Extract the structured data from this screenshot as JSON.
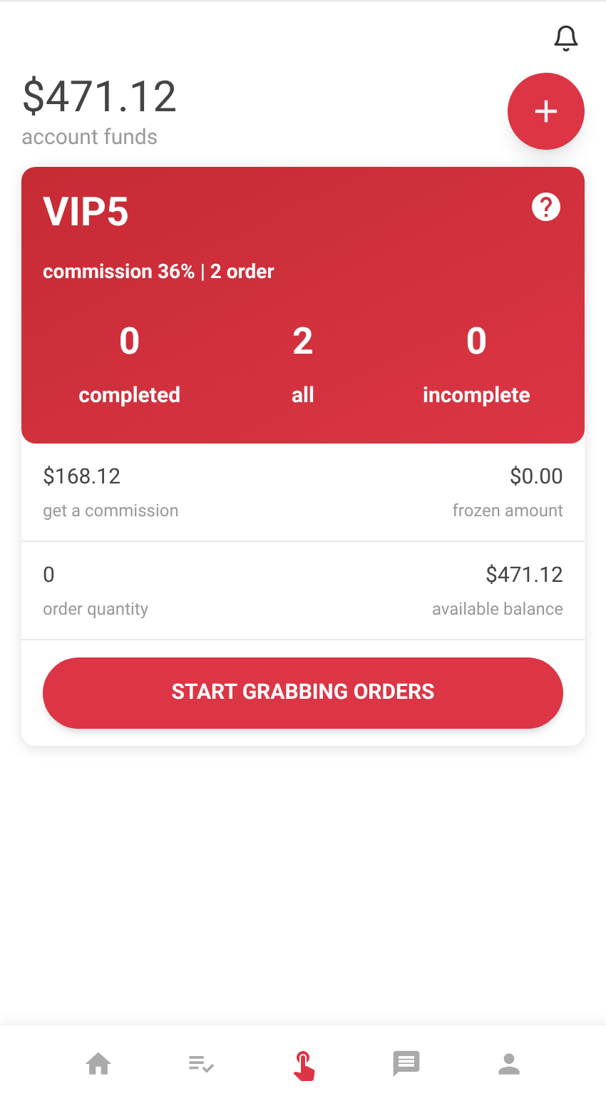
{
  "balance": {
    "amount": "$471.12",
    "label": "account funds"
  },
  "vip": {
    "level": "VIP5",
    "commission": "commission 36% | 2 order",
    "stats": [
      {
        "value": "0",
        "label": "completed"
      },
      {
        "value": "2",
        "label": "all"
      },
      {
        "value": "0",
        "label": "incomplete"
      }
    ]
  },
  "details": [
    [
      {
        "value": "$168.12",
        "label": "get a commission"
      },
      {
        "value": "$0.00",
        "label": "frozen amount"
      }
    ],
    [
      {
        "value": "0",
        "label": "order quantity"
      },
      {
        "value": "$471.12",
        "label": "available balance"
      }
    ]
  ],
  "start_button": "START GRABBING ORDERS",
  "nav": [
    {
      "kind": "home",
      "selected": false
    },
    {
      "kind": "tasks",
      "selected": false
    },
    {
      "kind": "grab",
      "selected": true
    },
    {
      "kind": "messages",
      "selected": false
    },
    {
      "kind": "profile",
      "selected": false
    }
  ]
}
